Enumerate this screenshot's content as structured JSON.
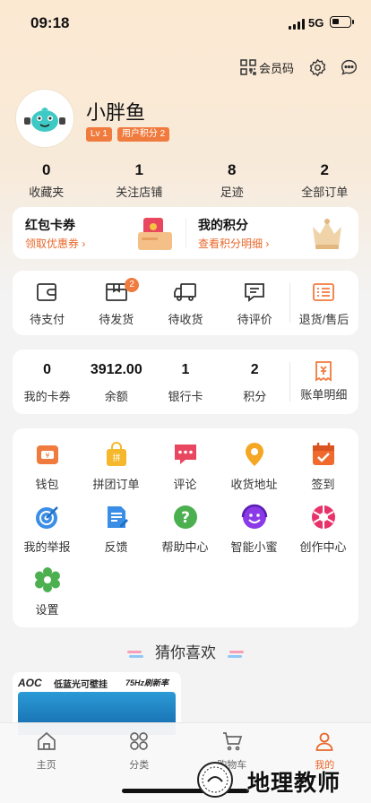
{
  "status_bar": {
    "time": "09:18",
    "network": "5G"
  },
  "header": {
    "member_code_label": "会员码",
    "icons": [
      "qr-code-icon",
      "settings-icon",
      "message-icon"
    ]
  },
  "profile": {
    "name": "小胖鱼",
    "level": "Lv 1",
    "points_badge": "用户积分 2"
  },
  "stats": [
    {
      "value": "0",
      "label": "收藏夹"
    },
    {
      "value": "1",
      "label": "关注店铺"
    },
    {
      "value": "8",
      "label": "足迹"
    },
    {
      "value": "2",
      "label": "全部订单"
    }
  ],
  "promo": {
    "left": {
      "title": "红包卡券",
      "link": "领取优惠券 ›"
    },
    "right": {
      "title": "我的积分",
      "link": "查看积分明细 ›"
    }
  },
  "orders": [
    {
      "label": "待支付",
      "icon": "wallet-icon"
    },
    {
      "label": "待发货",
      "icon": "package-icon",
      "badge": "2"
    },
    {
      "label": "待收货",
      "icon": "truck-icon"
    },
    {
      "label": "待评价",
      "icon": "comment-icon"
    },
    {
      "label": "退货/售后",
      "icon": "return-list-icon"
    }
  ],
  "wallet": [
    {
      "value": "0",
      "label": "我的卡券"
    },
    {
      "value": "3912.00",
      "label": "余额"
    },
    {
      "value": "1",
      "label": "银行卡"
    },
    {
      "value": "2",
      "label": "积分"
    },
    {
      "value": "",
      "label": "账单明细"
    }
  ],
  "tools": [
    {
      "label": "钱包",
      "icon": "wallet-icon",
      "color": "#f07b3e"
    },
    {
      "label": "拼团订单",
      "icon": "group-bag-icon",
      "color": "#f5b72b"
    },
    {
      "label": "评论",
      "icon": "comment-icon",
      "color": "#e8475f"
    },
    {
      "label": "收货地址",
      "icon": "location-pin-icon",
      "color": "#f5a623"
    },
    {
      "label": "签到",
      "icon": "calendar-check-icon",
      "color": "#f06a2e"
    },
    {
      "label": "我的举报",
      "icon": "target-icon",
      "color": "#3a8ee6"
    },
    {
      "label": "反馈",
      "icon": "feedback-icon",
      "color": "#3a8ee6"
    },
    {
      "label": "帮助中心",
      "icon": "help-icon",
      "color": "#4cb050"
    },
    {
      "label": "智能小蜜",
      "icon": "assistant-icon",
      "color": "#8a3ae6"
    },
    {
      "label": "创作中心",
      "icon": "aperture-icon",
      "color": "#e8336a"
    },
    {
      "label": "设置",
      "icon": "gear-icon",
      "color": "#4cb050"
    }
  ],
  "recommend_title": "猜你喜欢",
  "product": {
    "brand": "AOC",
    "title": "低蓝光可壁挂",
    "tag": "75Hz刷新率"
  },
  "tabbar": [
    {
      "label": "主页",
      "icon": "home-icon"
    },
    {
      "label": "分类",
      "icon": "category-icon"
    },
    {
      "label": "购物车",
      "icon": "cart-icon"
    },
    {
      "label": "我的",
      "icon": "profile-icon",
      "active": true
    }
  ],
  "watermark": "地理教师",
  "colors": {
    "accent": "#e8672a",
    "badge": "#f07b3e",
    "bg": "#f3f3f3"
  }
}
